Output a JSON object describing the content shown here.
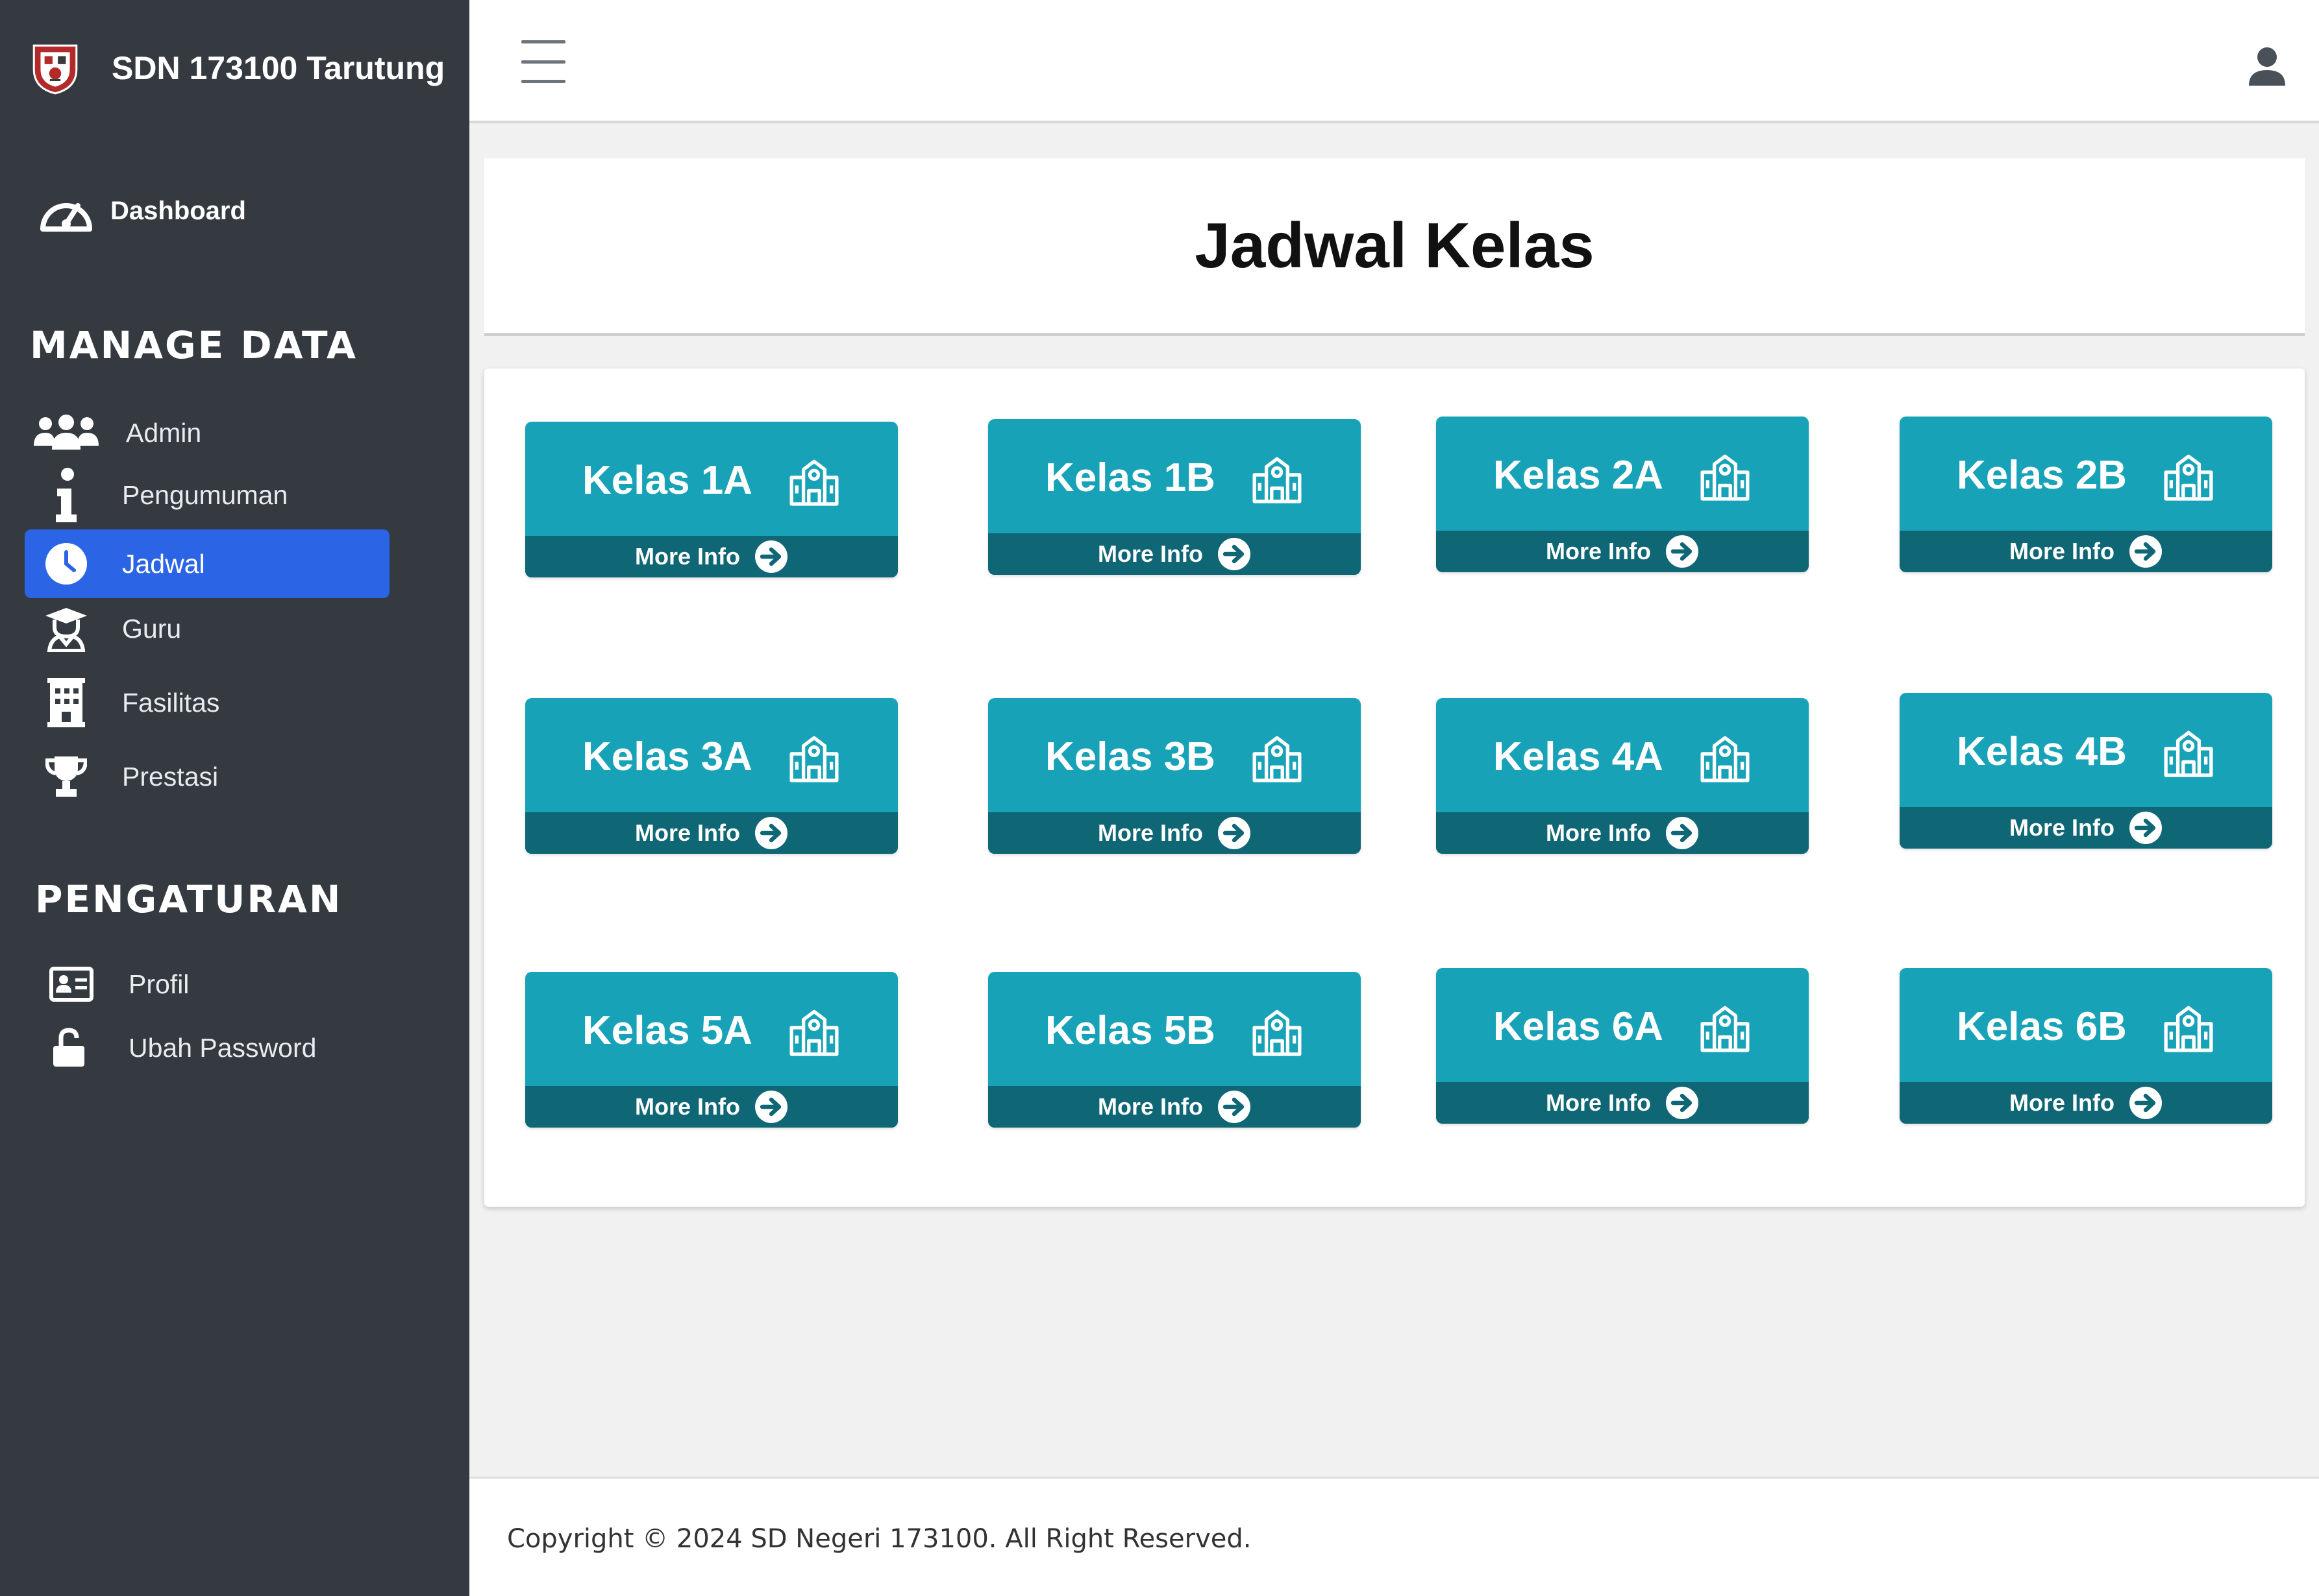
{
  "brand": {
    "name": "SDN 173100 Tarutung"
  },
  "sidebar": {
    "dashboard_label": "Dashboard",
    "manage_title": "MANAGE DATA",
    "manage_items": [
      {
        "label": "Admin",
        "icon": "users-icon"
      },
      {
        "label": "Pengumuman",
        "icon": "info-icon"
      },
      {
        "label": "Jadwal",
        "icon": "clock-icon",
        "active": true
      },
      {
        "label": "Guru",
        "icon": "teacher-icon"
      },
      {
        "label": "Fasilitas",
        "icon": "building-icon"
      },
      {
        "label": "Prestasi",
        "icon": "trophy-icon"
      }
    ],
    "settings_title": "PENGATURAN",
    "settings_items": [
      {
        "label": "Profil",
        "icon": "id-card-icon"
      },
      {
        "label": "Ubah Password",
        "icon": "lock-icon"
      }
    ]
  },
  "page": {
    "title": "Jadwal Kelas"
  },
  "classes": [
    {
      "name": "Kelas 1A",
      "more": "More Info"
    },
    {
      "name": "Kelas 1B",
      "more": "More Info"
    },
    {
      "name": "Kelas 2A",
      "more": "More Info"
    },
    {
      "name": "Kelas 2B",
      "more": "More Info"
    },
    {
      "name": "Kelas 3A",
      "more": "More Info"
    },
    {
      "name": "Kelas 3B",
      "more": "More Info"
    },
    {
      "name": "Kelas 4A",
      "more": "More Info"
    },
    {
      "name": "Kelas 4B",
      "more": "More Info"
    },
    {
      "name": "Kelas 5A",
      "more": "More Info"
    },
    {
      "name": "Kelas 5B",
      "more": "More Info"
    },
    {
      "name": "Kelas 6A",
      "more": "More Info"
    },
    {
      "name": "Kelas 6B",
      "more": "More Info"
    }
  ],
  "footer": {
    "copyright": "Copyright © 2024 SD Negeri 173100. All Right Reserved."
  },
  "colors": {
    "sidebar": "#343a40",
    "active": "#2b65e6",
    "card": "#18a2b8",
    "card_footer": "#0f6675"
  }
}
